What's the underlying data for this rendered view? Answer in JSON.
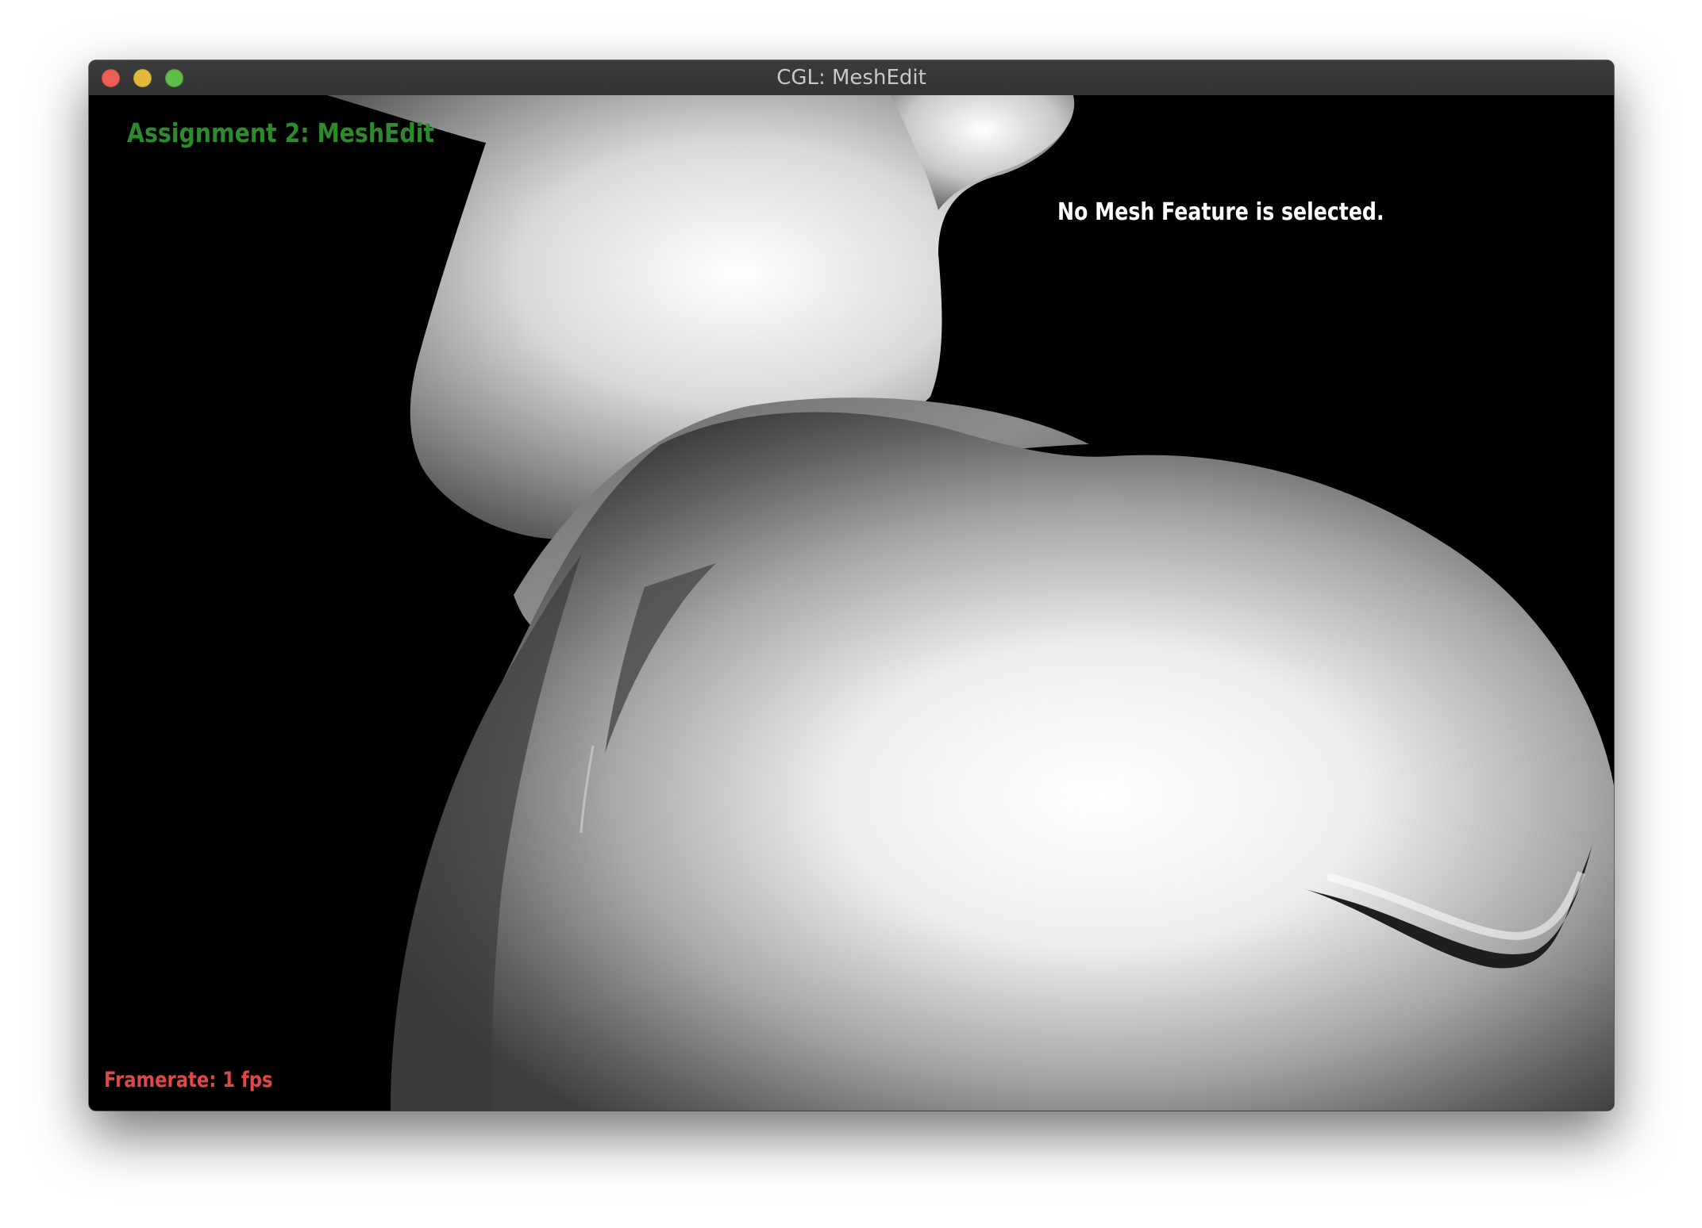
{
  "window": {
    "title": "CGL: MeshEdit",
    "controls": {
      "close": "close-button",
      "minimize": "minimize-button",
      "maximize": "maximize-button"
    }
  },
  "viewport": {
    "assignment_title": "Assignment 2: MeshEdit",
    "status": "No Mesh Feature is selected.",
    "framerate": "Framerate: 1 fps"
  },
  "colors": {
    "assignment_title": "#2d8a2d",
    "status": "#ffffff",
    "framerate": "#e04848",
    "background": "#000000"
  }
}
